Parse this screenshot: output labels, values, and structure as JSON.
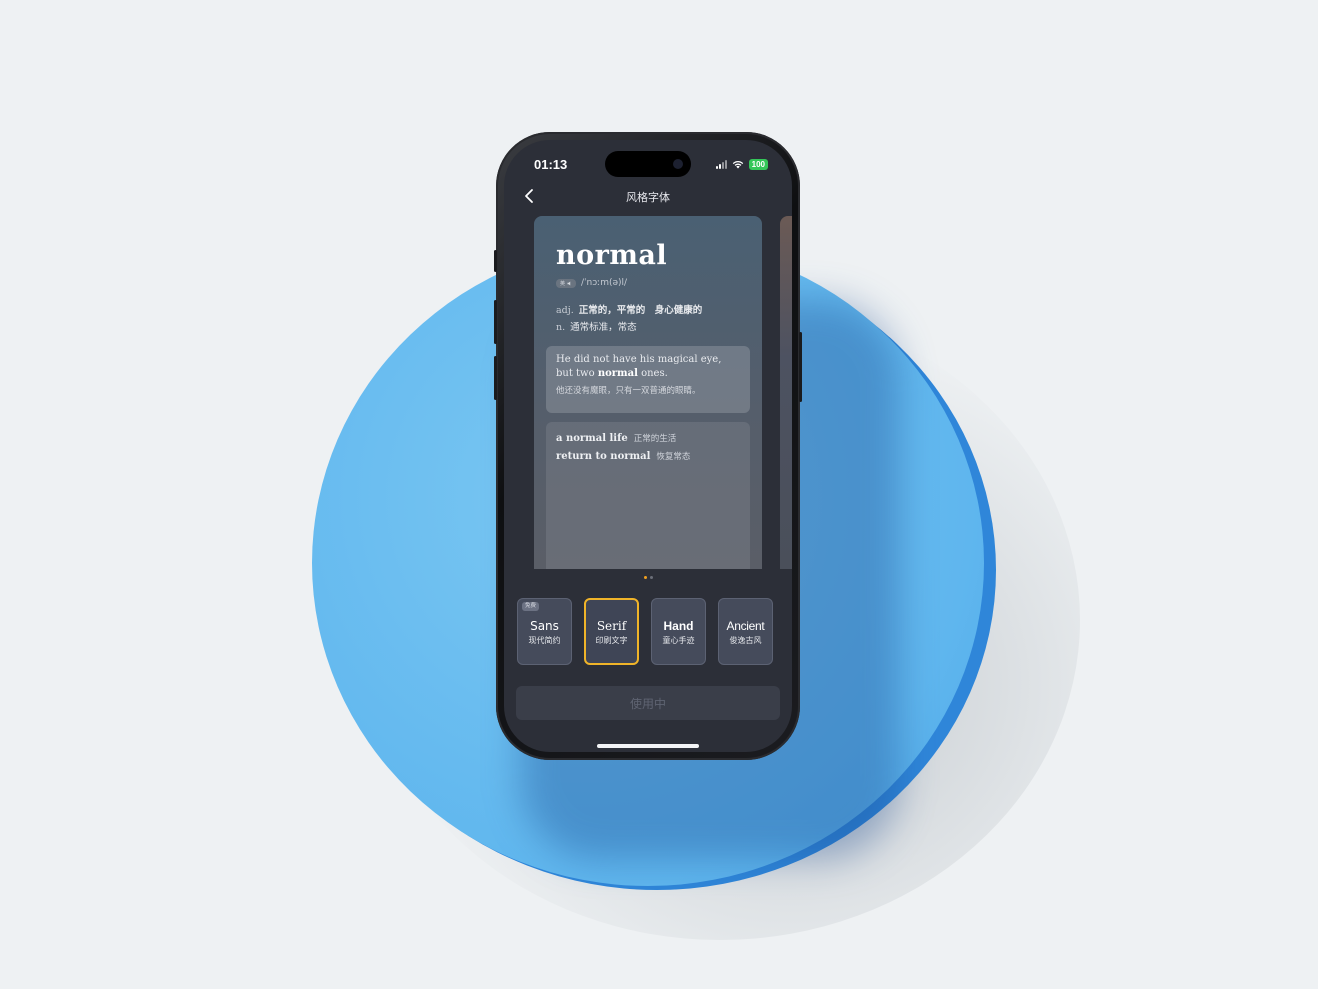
{
  "status_bar": {
    "time": "01:13",
    "battery": "100"
  },
  "nav": {
    "title": "风格字体",
    "back_icon": "chevron-left-icon"
  },
  "card": {
    "word": "normal",
    "accent_label": "英",
    "phonetic": "/ˈnɔːm(ə)l/",
    "definitions": [
      {
        "pos": "adj.",
        "meaning": "正常的，平常的　身心健康的"
      },
      {
        "pos": "n.",
        "meaning": "通常标准，常态"
      }
    ],
    "example": {
      "en_before": "He did not have his magical eye, but two ",
      "en_bold": "normal",
      "en_after": " ones.",
      "cn": "他还没有魔眼，只有一双普通的眼睛。"
    },
    "phrases": [
      {
        "en": "a normal life",
        "cn": "正常的生活"
      },
      {
        "en": "return to normal",
        "cn": "恢复常态"
      }
    ]
  },
  "pager": {
    "count": 2,
    "active": 0
  },
  "fonts": [
    {
      "name": "Sans",
      "subtitle": "现代简约",
      "badge": "免费",
      "selected": false
    },
    {
      "name": "Serif",
      "subtitle": "印刷文字",
      "badge": "",
      "selected": true
    },
    {
      "name": "Hand",
      "subtitle": "童心手迹",
      "badge": "",
      "selected": false
    },
    {
      "name": "Ancient",
      "subtitle": "俊逸古风",
      "badge": "",
      "selected": false
    }
  ],
  "use_button": {
    "label": "使用中"
  },
  "colors": {
    "accent": "#f0b429",
    "battery": "#34c759",
    "pedestal": "#5fb6ee"
  }
}
